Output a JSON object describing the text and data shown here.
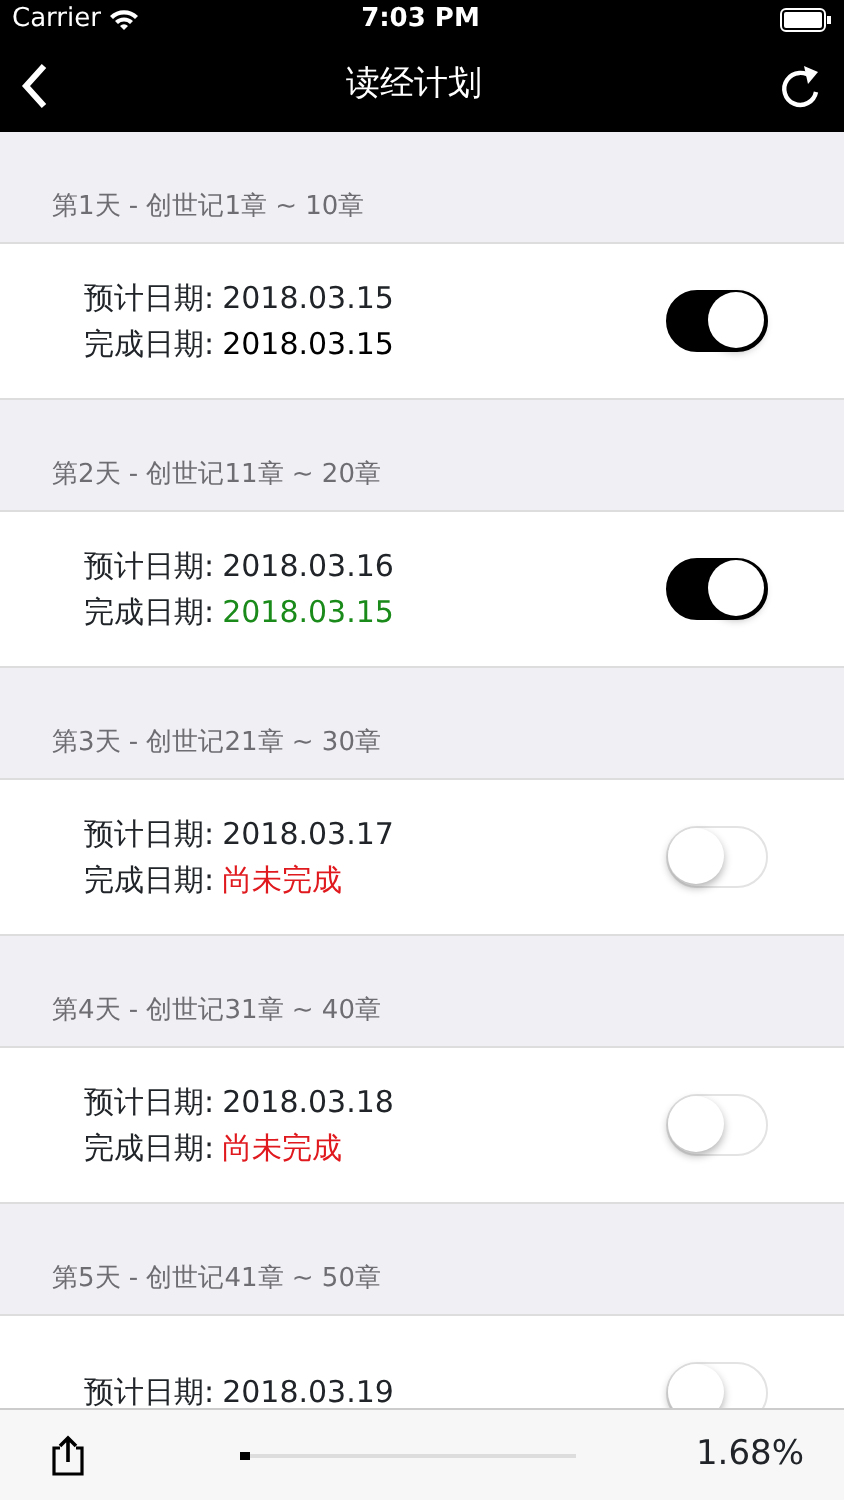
{
  "status_bar": {
    "carrier": "Carrier",
    "time": "7:03 PM"
  },
  "nav": {
    "title": "读经计划"
  },
  "days": [
    {
      "header": "第1天 - 创世记1章 ~ 10章",
      "planned_label": "预计日期:",
      "planned": "2018.03.15",
      "completed_label": "完成日期:",
      "completed": "2018.03.15",
      "color": "#000000",
      "on": true
    },
    {
      "header": "第2天 - 创世记11章 ~ 20章",
      "planned_label": "预计日期:",
      "planned": "2018.03.16",
      "completed_label": "完成日期:",
      "completed": "2018.03.15",
      "color": "#1a8a1a",
      "on": true
    },
    {
      "header": "第3天 - 创世记21章 ~ 30章",
      "planned_label": "预计日期:",
      "planned": "2018.03.17",
      "completed_label": "完成日期:",
      "completed": "尚未完成",
      "color": "#e0191e",
      "on": false
    },
    {
      "header": "第4天 - 创世记31章 ~ 40章",
      "planned_label": "预计日期:",
      "planned": "2018.03.18",
      "completed_label": "完成日期:",
      "completed": "尚未完成",
      "color": "#e0191e",
      "on": false
    },
    {
      "header": "第5天 - 创世记41章 ~ 50章",
      "planned_label": "预计日期:",
      "planned": "2018.03.19",
      "on": false
    }
  ],
  "toolbar": {
    "level": 0.03,
    "percent": "1.68%"
  }
}
